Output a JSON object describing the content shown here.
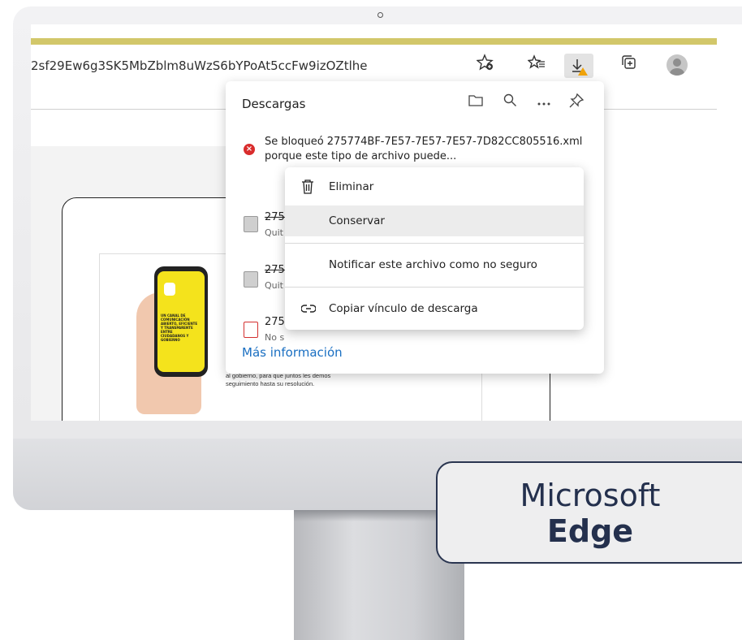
{
  "browser": {
    "address_text": "2sf29Ew6g3SK5MbZblm8uWzS6bYPoAt5ccFw9izOZtlhe"
  },
  "toolbar": {
    "icons": [
      "favorite-add-icon",
      "favorites-icon",
      "download-icon",
      "collections-icon",
      "profile-avatar"
    ],
    "accent_color": "#d2c76a"
  },
  "downloads": {
    "title": "Descargas",
    "header_icons": [
      "folder-icon",
      "search-icon",
      "more-icon",
      "pin-icon"
    ],
    "blocked_item": "Se bloqueó 275774BF-7E57-7E57-7E57-7D82CC805516.xml porque este tipo de archivo puede...",
    "rows": [
      {
        "name": "275",
        "sub": "Quit"
      },
      {
        "name": "275",
        "sub": "Quit"
      },
      {
        "name": "275",
        "sub": "No s"
      }
    ],
    "more_info": "Más información"
  },
  "context_menu": {
    "items": [
      {
        "label": "Eliminar",
        "icon": "trash-icon"
      },
      {
        "label": "Conservar",
        "icon": ""
      },
      {
        "label": "Notificar este archivo como no seguro",
        "icon": ""
      },
      {
        "label": "Copiar vínculo de descarga",
        "icon": "link-icon"
      }
    ]
  },
  "page_content": {
    "doc_text_1": "al gobierno, para que juntos les demos",
    "doc_text_2": "seguimiento hasta su resolución.",
    "phone_text": "UN CANAL DE COMUNICACIÓN ABIERTO, EFICIENTE Y TRANSPARENTE ENTRE CIUDADANOS Y GOBIERNO"
  },
  "badge": {
    "line1": "Microsoft",
    "line2": "Edge"
  }
}
